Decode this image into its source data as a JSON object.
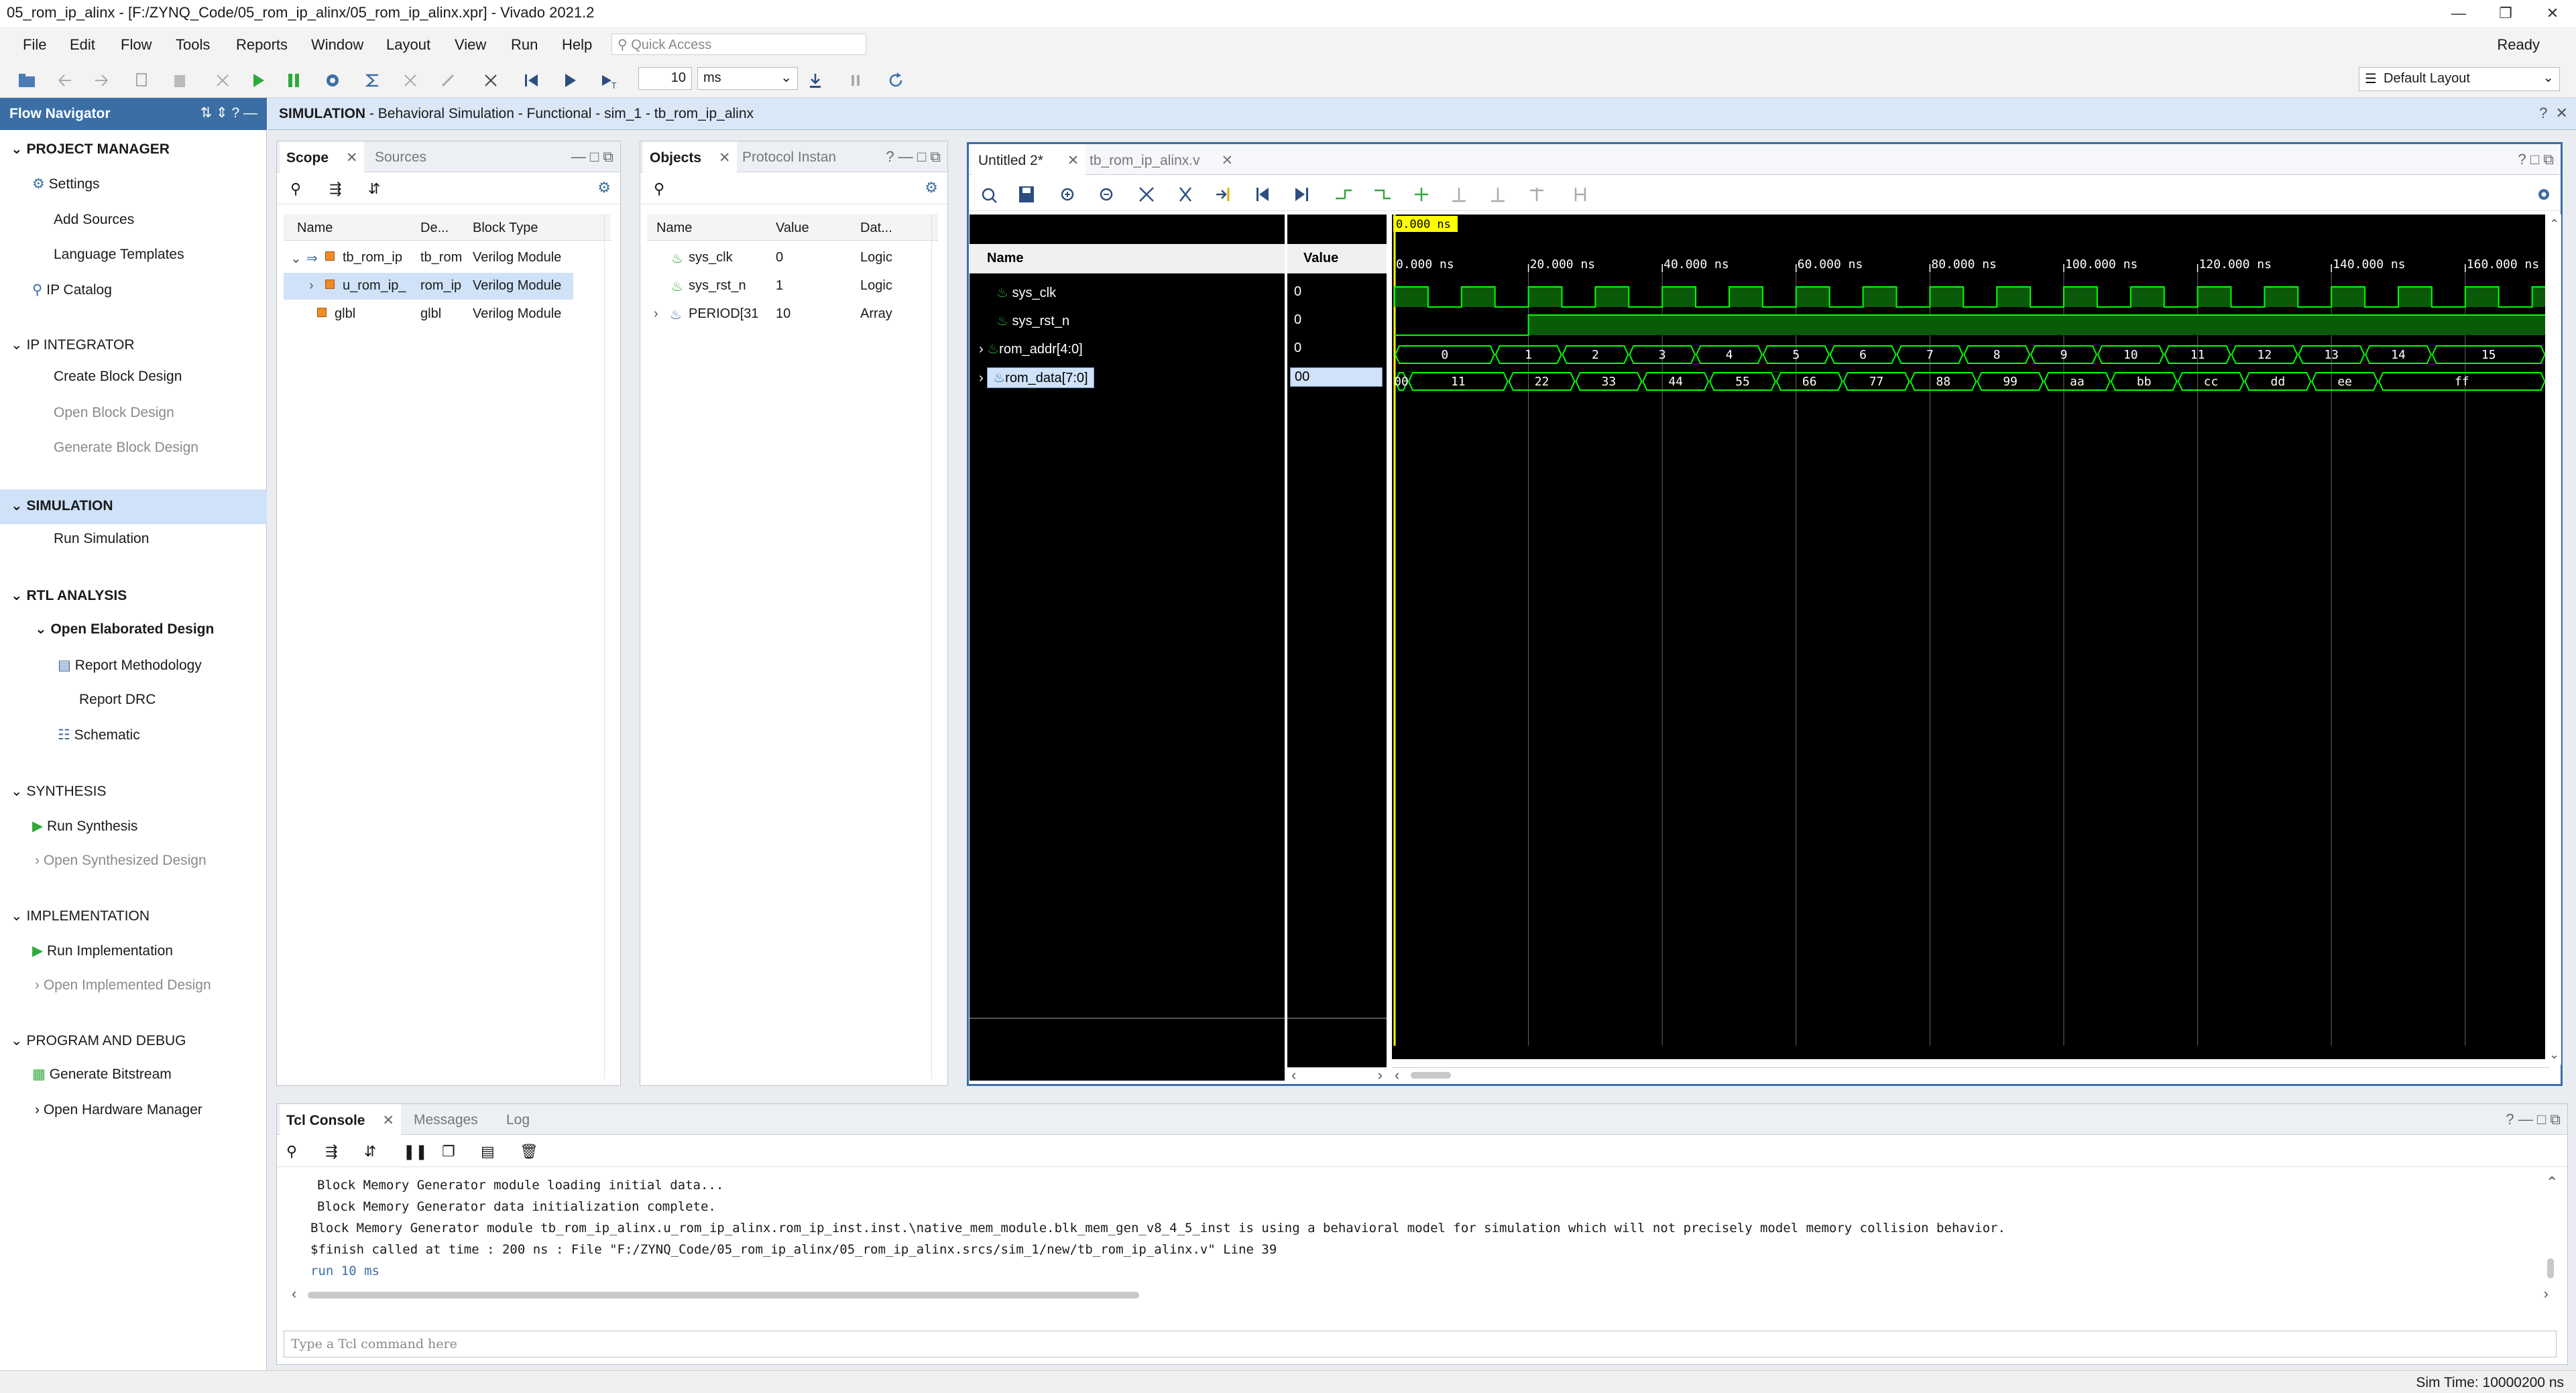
{
  "window": {
    "title": "05_rom_ip_alinx - [F:/ZYNQ_Code/05_rom_ip_alinx/05_rom_ip_alinx.xpr] - Vivado 2021.2",
    "status": "Ready"
  },
  "menu": [
    "File",
    "Edit",
    "Flow",
    "Tools",
    "Reports",
    "Window",
    "Layout",
    "View",
    "Run",
    "Help"
  ],
  "quick_access": {
    "placeholder": "Quick Access"
  },
  "toolbar": {
    "run_value": "10",
    "run_unit": "ms",
    "layout": "Default Layout"
  },
  "flow_navigator": {
    "title": "Flow Navigator",
    "project_manager": {
      "label": "PROJECT MANAGER",
      "settings": "Settings",
      "add_sources": "Add Sources",
      "language_templates": "Language Templates",
      "ip_catalog": "IP Catalog"
    },
    "ip_integrator": {
      "label": "IP INTEGRATOR",
      "create_block_design": "Create Block Design",
      "open_block_design": "Open Block Design",
      "generate_block_design": "Generate Block Design"
    },
    "simulation": {
      "label": "SIMULATION",
      "run_simulation": "Run Simulation"
    },
    "rtl_analysis": {
      "label": "RTL ANALYSIS",
      "open_elaborated": "Open Elaborated Design",
      "report_methodology": "Report Methodology",
      "report_drc": "Report DRC",
      "schematic": "Schematic"
    },
    "synthesis": {
      "label": "SYNTHESIS",
      "run_synthesis": "Run Synthesis",
      "open_synthesized": "Open Synthesized Design"
    },
    "implementation": {
      "label": "IMPLEMENTATION",
      "run_implementation": "Run Implementation",
      "open_implemented": "Open Implemented Design"
    },
    "program_debug": {
      "label": "PROGRAM AND DEBUG",
      "generate_bitstream": "Generate Bitstream",
      "open_hardware_manager": "Open Hardware Manager"
    }
  },
  "sim_header": {
    "title": "SIMULATION",
    "subtitle": " - Behavioral Simulation - Functional - sim_1 - tb_rom_ip_alinx"
  },
  "scope_panel": {
    "tabs": [
      "Scope",
      "Sources"
    ],
    "columns": [
      "Name",
      "De...",
      "Block Type"
    ],
    "rows": [
      {
        "name": "tb_rom_ip",
        "def": "tb_rom",
        "type": "Verilog Module"
      },
      {
        "name": "u_rom_ip_",
        "def": "rom_ip",
        "type": "Verilog Module"
      },
      {
        "name": "glbl",
        "def": "glbl",
        "type": "Verilog Module"
      }
    ]
  },
  "objects_panel": {
    "tabs": [
      "Objects",
      "Protocol Instan"
    ],
    "columns": [
      "Name",
      "Value",
      "Dat..."
    ],
    "rows": [
      {
        "name": "sys_clk",
        "value": "0",
        "type": "Logic"
      },
      {
        "name": "sys_rst_n",
        "value": "1",
        "type": "Logic"
      },
      {
        "name": "PERIOD[31",
        "value": "10",
        "type": "Array"
      }
    ]
  },
  "wave_panel": {
    "tabs": [
      "Untitled 2*",
      "tb_rom_ip_alinx.v"
    ],
    "name_header": "Name",
    "value_header": "Value",
    "cursor_time": "0.000 ns",
    "time_ticks": [
      "0.000 ns",
      "20.000 ns",
      "40.000 ns",
      "60.000 ns",
      "80.000 ns",
      "100.000 ns",
      "120.000 ns",
      "140.000 ns",
      "160.000 ns"
    ],
    "signals": [
      {
        "name": "sys_clk",
        "value": "0"
      },
      {
        "name": "sys_rst_n",
        "value": "0"
      },
      {
        "name": "rom_addr[4:0]",
        "value": "0"
      },
      {
        "name": "rom_data[7:0]",
        "value": "00"
      }
    ],
    "addr_labels": [
      "0",
      "1",
      "2",
      "3",
      "4",
      "5",
      "6",
      "7",
      "8",
      "9",
      "10",
      "11",
      "12",
      "13",
      "14",
      "15"
    ],
    "data_labels": [
      "00",
      "11",
      "22",
      "33",
      "44",
      "55",
      "66",
      "77",
      "88",
      "99",
      "aa",
      "bb",
      "cc",
      "dd",
      "ee",
      "ff"
    ]
  },
  "console": {
    "tabs": [
      "Tcl Console",
      "Messages",
      "Log"
    ],
    "lines": [
      "Block Memory Generator module loading initial data...",
      "Block Memory Generator data initialization complete.",
      "Block Memory Generator module tb_rom_ip_alinx.u_rom_ip_alinx.rom_ip_inst.inst.\\native_mem_module.blk_mem_gen_v8_4_5_inst  is using a behavioral model for simulation which will not precisely model memory collision behavior.",
      "$finish called at time : 200 ns : File \"F:/ZYNQ_Code/05_rom_ip_alinx/05_rom_ip_alinx.srcs/sim_1/new/tb_rom_ip_alinx.v\" Line 39",
      "run 10 ms"
    ],
    "placeholder": "Type a Tcl command here"
  },
  "statusbar": {
    "sim_time": "Sim Time: 10000200 ns"
  },
  "colors": {
    "accent": "#3b6ea5",
    "wave_green": "#00ff00",
    "selection": "#cfe2f8",
    "cursor": "#ffff00"
  }
}
